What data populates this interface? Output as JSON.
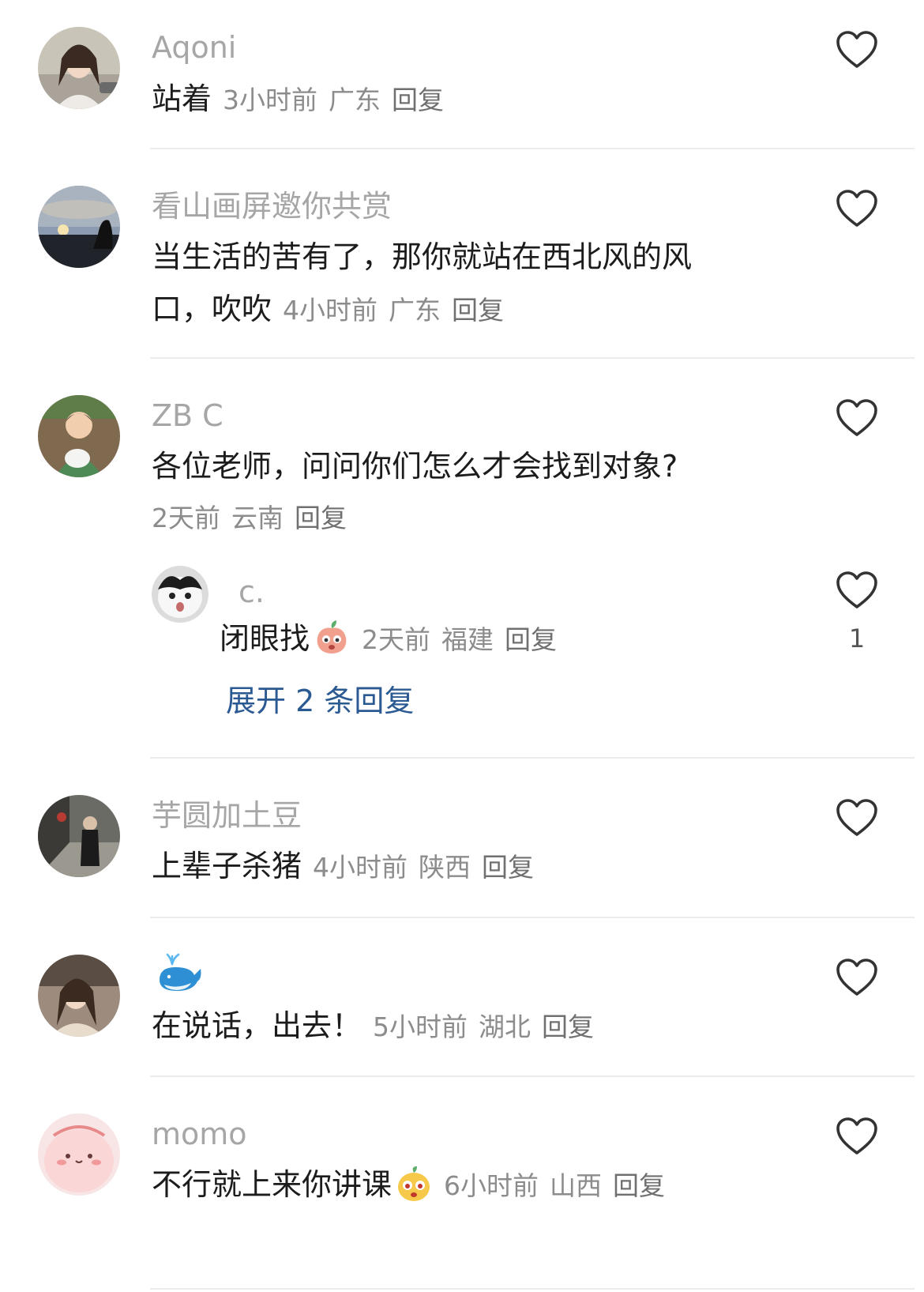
{
  "comments": [
    {
      "username": "Aqoni",
      "text": "站着",
      "time": "3小时前",
      "location": "广东",
      "reply": "回复",
      "avatar": "woman-avatar"
    },
    {
      "username": "看山画屏邀你共赏",
      "text_line1": "当生活的苦有了，那你就站在西北风的风",
      "text_line2": "口，吹吹",
      "time": "4小时前",
      "location": "广东",
      "reply": "回复",
      "avatar": "sunset-avatar"
    },
    {
      "username": "ZB C",
      "text": "各位老师，问问你们怎么才会找到对象?",
      "time": "2天前",
      "location": "云南",
      "reply": "回复",
      "avatar": "boy-cat-avatar",
      "replies": [
        {
          "username": "c.",
          "text": "闭眼找",
          "emoji": "peach-emoji",
          "time": "2天前",
          "location": "福建",
          "reply": "回复",
          "likes": "1",
          "avatar": "cat-avatar"
        }
      ],
      "expand_label": "展开 2 条回复"
    },
    {
      "username": "芋圆加土豆",
      "text": "上辈子杀猪",
      "time": "4小时前",
      "location": "陕西",
      "reply": "回复",
      "avatar": "street-avatar"
    },
    {
      "username_emoji": "whale-emoji",
      "text": "在说话，出去！",
      "time": "5小时前",
      "location": "湖北",
      "reply": "回复",
      "avatar": "girl-avatar"
    },
    {
      "username": "momo",
      "text": "不行就上来你讲课",
      "emoji": "chick-emoji",
      "time": "6小时前",
      "location": "山西",
      "reply": "回复",
      "avatar": "pink-blob-avatar"
    }
  ],
  "colors": {
    "username": "#a6a6a6",
    "text": "#1c1c1c",
    "meta": "#8c8c8c",
    "link": "#2b5a93",
    "divider": "#ececec"
  }
}
